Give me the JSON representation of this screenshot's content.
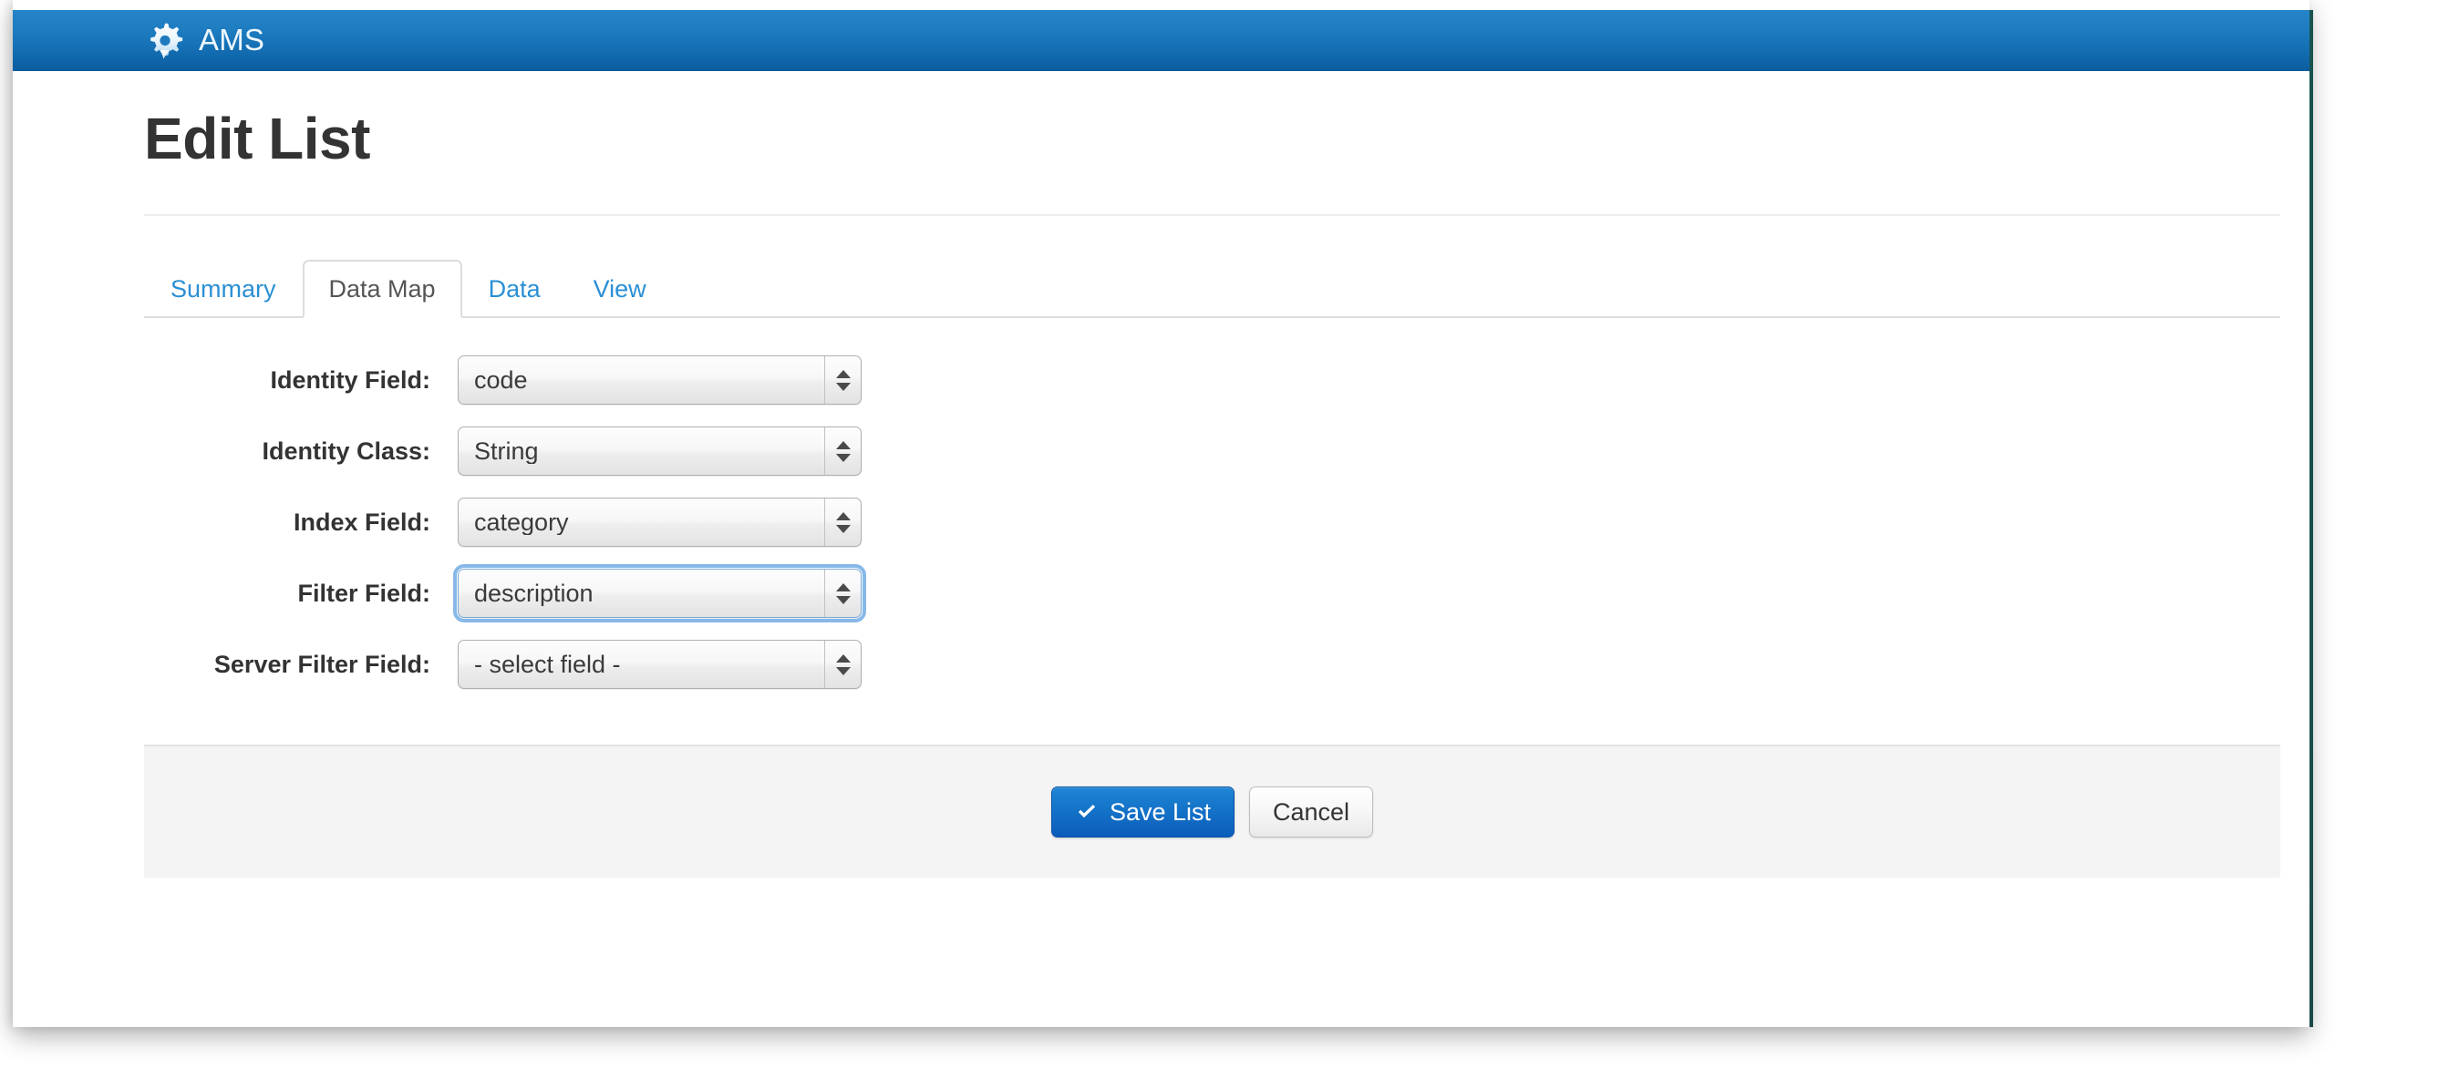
{
  "navbar": {
    "brand_label": "AMS",
    "brand_icon": "gear-icon",
    "bg_start": "#2684c8",
    "bg_end": "#0c5c9e"
  },
  "page": {
    "title": "Edit List"
  },
  "tabs": [
    {
      "label": "Summary",
      "active": false
    },
    {
      "label": "Data Map",
      "active": true
    },
    {
      "label": "Data",
      "active": false
    },
    {
      "label": "View",
      "active": false
    }
  ],
  "form": {
    "fields": [
      {
        "label": "Identity Field:",
        "value": "code",
        "name": "identity-field-select",
        "focused": false
      },
      {
        "label": "Identity Class:",
        "value": "String",
        "name": "identity-class-select",
        "focused": false
      },
      {
        "label": "Index Field:",
        "value": "category",
        "name": "index-field-select",
        "focused": false
      },
      {
        "label": "Filter Field:",
        "value": "description",
        "name": "filter-field-select",
        "focused": true
      },
      {
        "label": "Server Filter Field:",
        "value": "- select field -",
        "name": "server-filter-field-select",
        "focused": false
      }
    ]
  },
  "footer": {
    "save_label": "Save List",
    "save_icon": "check-icon",
    "cancel_label": "Cancel"
  },
  "colors": {
    "link": "#2a8fd4",
    "primary_button": "#1473c8",
    "focus_ring": "#87b8e8",
    "panel_bg": "#f4f4f4"
  }
}
